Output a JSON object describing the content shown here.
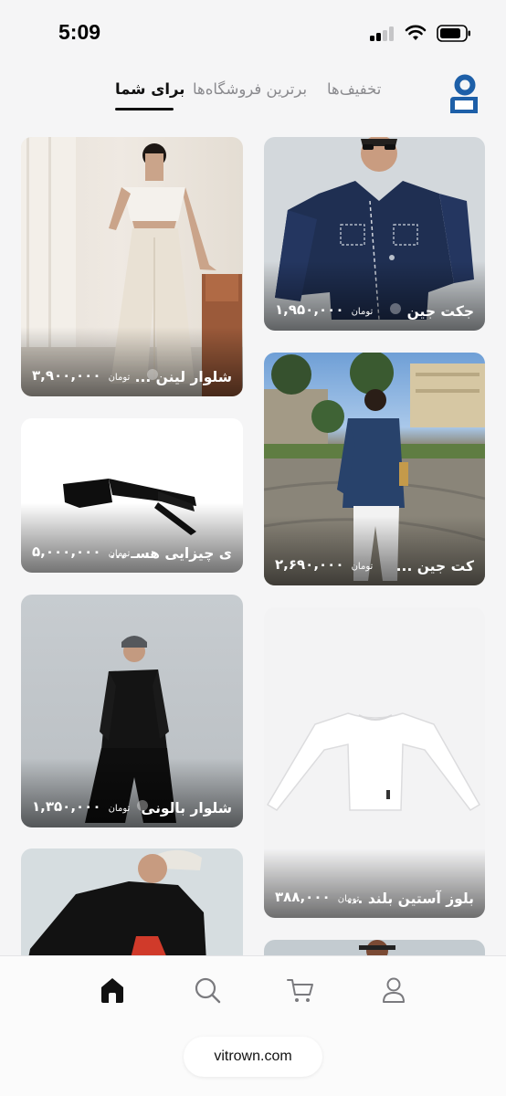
{
  "status": {
    "time": "5:09"
  },
  "tabs": {
    "discounts": "تخفیف‌ها",
    "top_stores": "برترین فروشگاه‌ها",
    "for_you": "برای شما",
    "active": "for_you"
  },
  "products": [
    {
      "title": "شلوار لینن ...",
      "price": "۳,۹۰۰,۰۰۰",
      "currency": "تومان"
    },
    {
      "title": "جکت جین",
      "price": "۱,۹۵۰,۰۰۰",
      "currency": "تومان"
    },
    {
      "title": "ی چیزایی هسـ ...",
      "price": "۵,۰۰۰,۰۰۰",
      "currency": "تومان"
    },
    {
      "title": "کت جین ...",
      "price": "۲,۶۹۰,۰۰۰",
      "currency": "تومان"
    },
    {
      "title": "شلوار بالونی",
      "price": "۱,۳۵۰,۰۰۰",
      "currency": "تومان"
    },
    {
      "title": "بلوز آستین بلند ...",
      "price": "۳۸۸,۰۰۰",
      "currency": "تومان"
    }
  ],
  "nav": {
    "items": [
      "home-icon",
      "search-icon",
      "cart-icon",
      "profile-icon"
    ],
    "active": "home-icon"
  },
  "browser": {
    "url": "vitrown.com"
  },
  "colors": {
    "brand": "#1d5fa8",
    "background": "#f5f5f6"
  }
}
